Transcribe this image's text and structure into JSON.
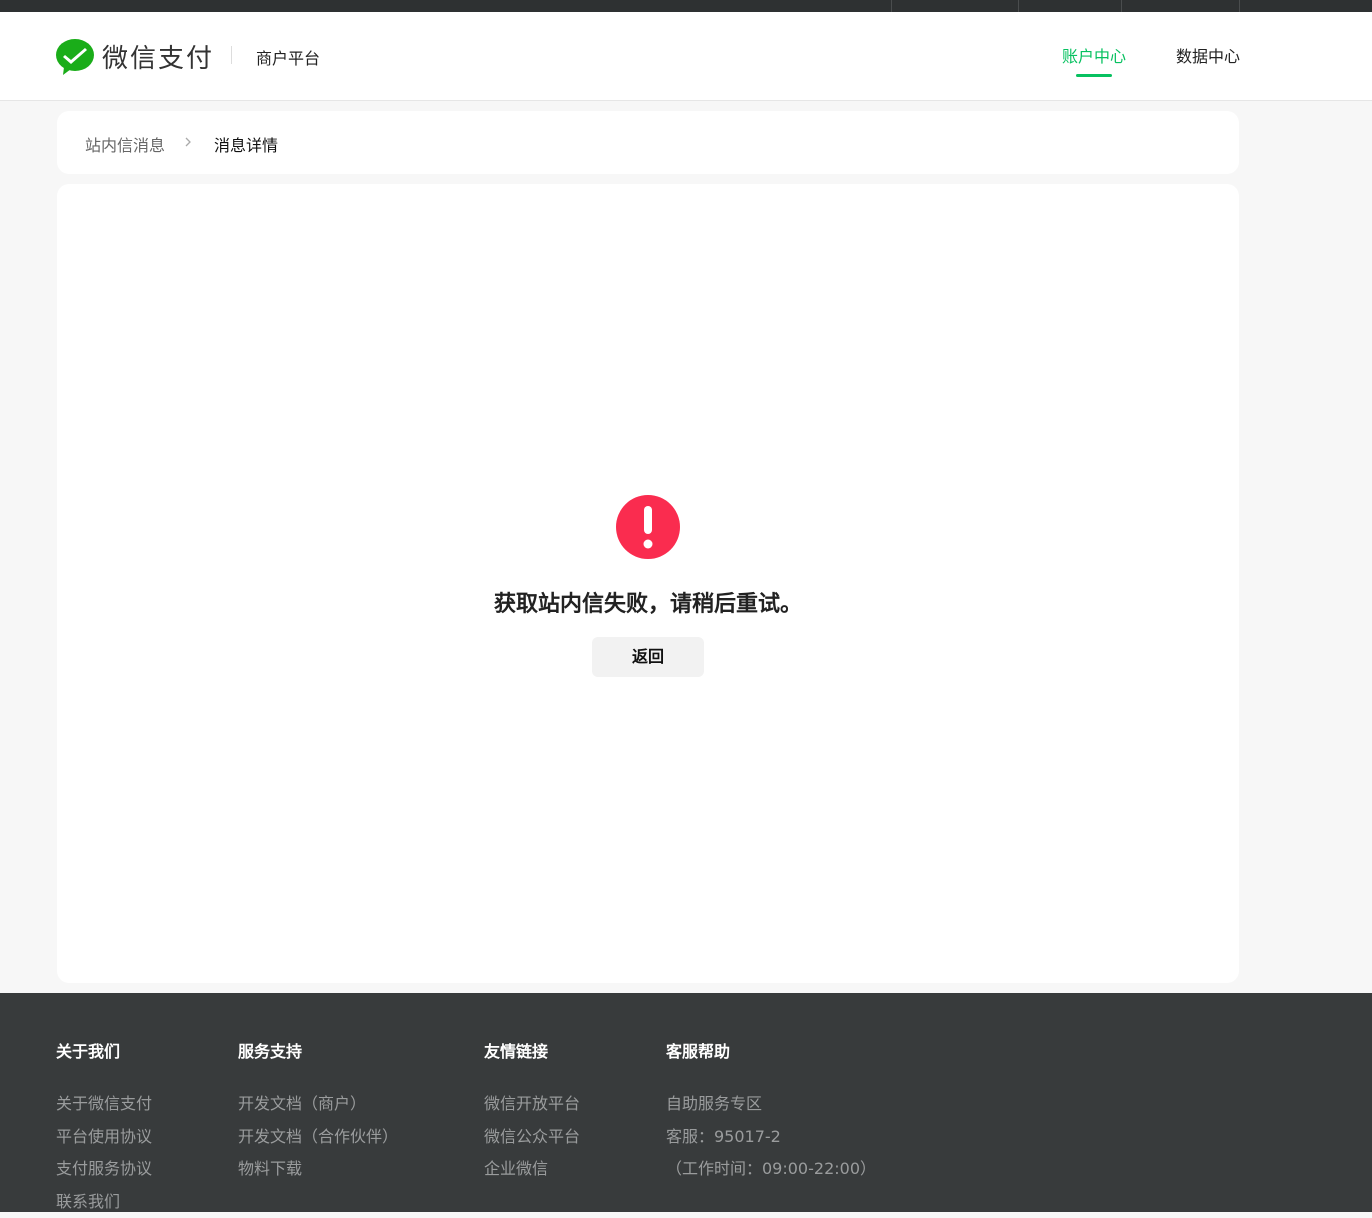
{
  "header": {
    "logo_text": "微信支付",
    "platform": "商户平台",
    "nav": [
      {
        "label": "账户中心",
        "active": true
      },
      {
        "label": "数据中心",
        "active": false
      }
    ]
  },
  "breadcrumb": {
    "parent": "站内信消息",
    "current": "消息详情"
  },
  "main": {
    "error_message": "获取站内信失败，请稍后重试。",
    "back_label": "返回"
  },
  "colors": {
    "brand": "#07c160",
    "error": "#fa2c4f",
    "footer_bg": "#383b3c"
  },
  "footer": {
    "columns": [
      {
        "title": "关于我们",
        "links": [
          "关于微信支付",
          "平台使用协议",
          "支付服务协议",
          "联系我们"
        ]
      },
      {
        "title": "服务支持",
        "links": [
          "开发文档（商户）",
          "开发文档（合作伙伴）",
          "物料下载"
        ]
      },
      {
        "title": "友情链接",
        "links": [
          "微信开放平台",
          "微信公众平台",
          "企业微信"
        ]
      },
      {
        "title": "客服帮助",
        "links": [
          "自助服务专区",
          "客服：95017-2",
          "（工作时间：09:00-22:00）"
        ]
      }
    ]
  }
}
